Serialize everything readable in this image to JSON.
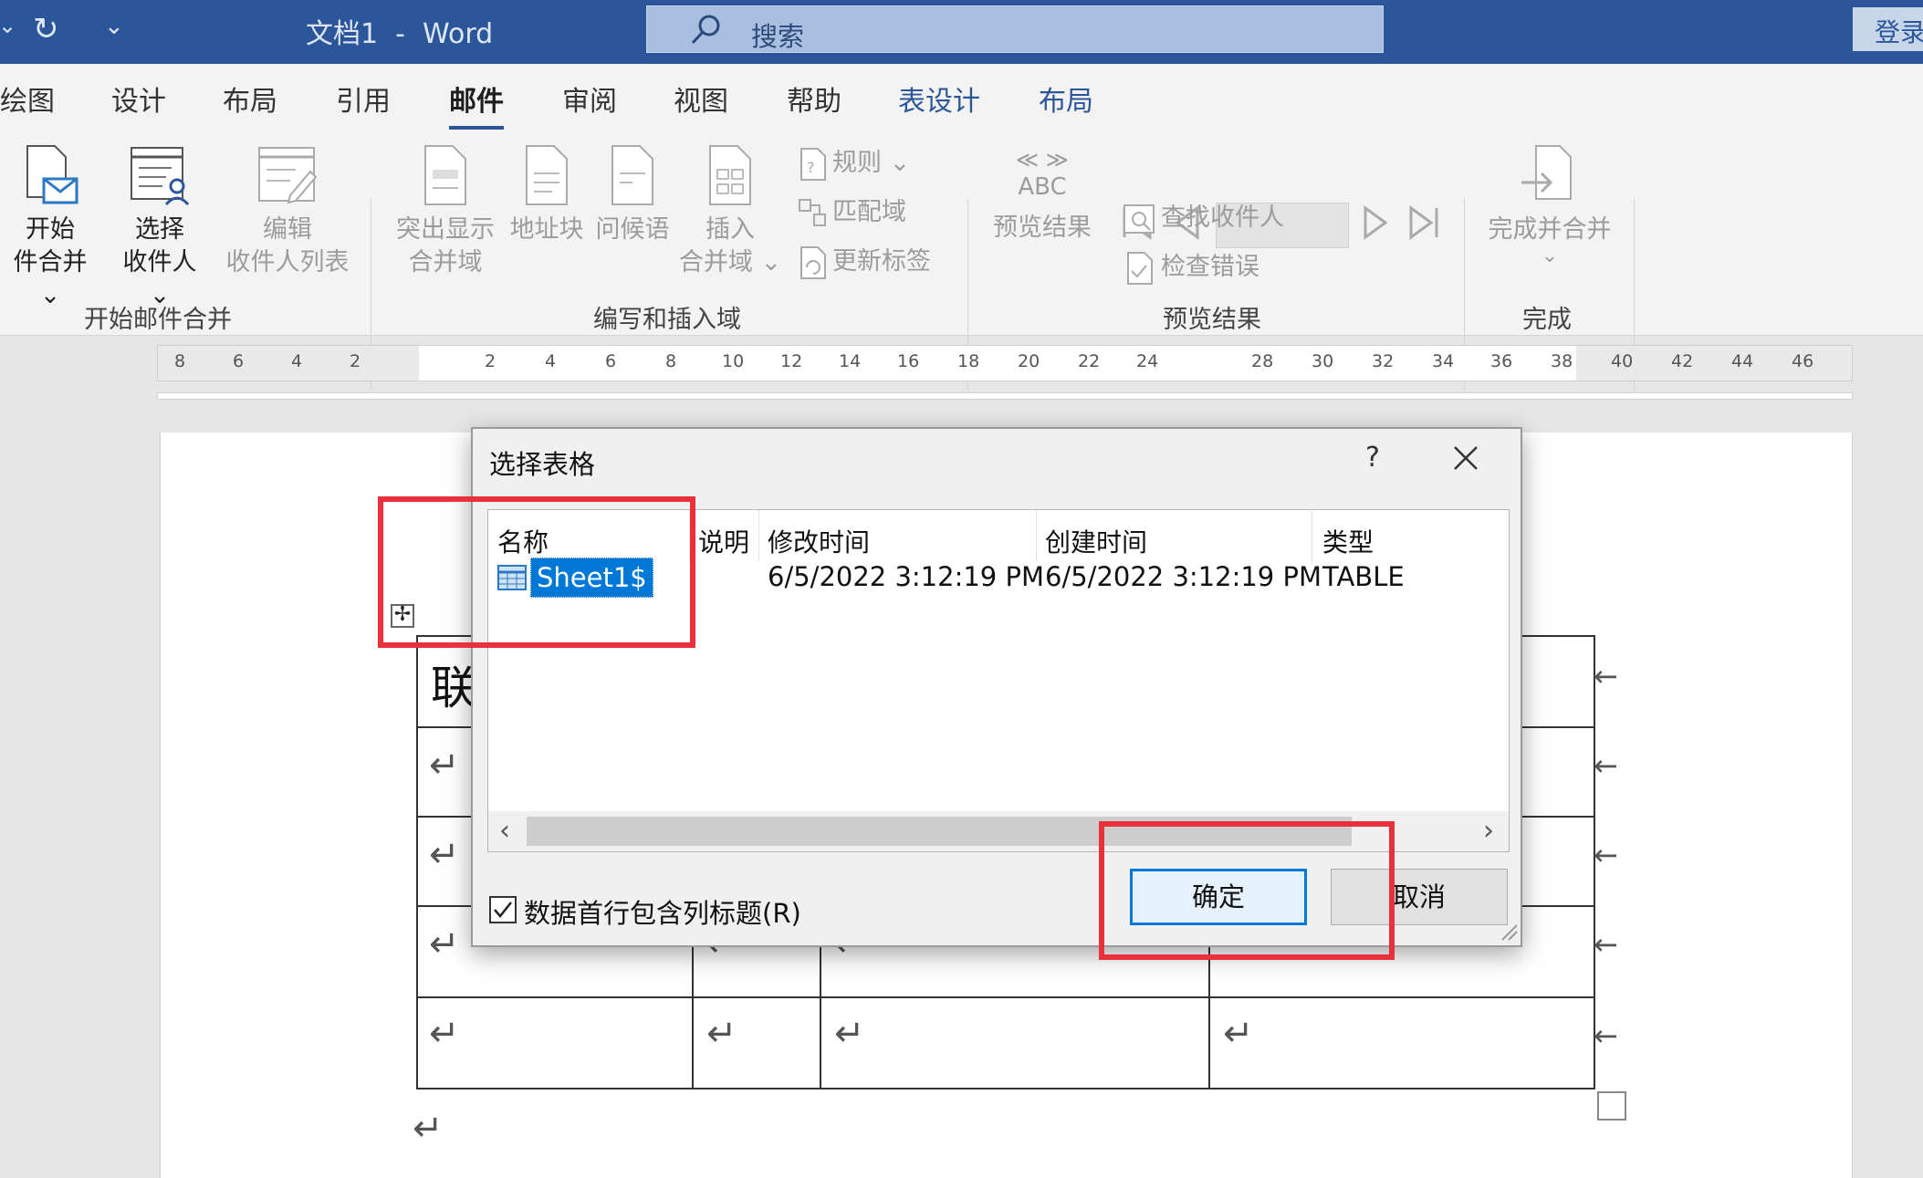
{
  "titlebar": {
    "doc_title": "文档1  -  Word",
    "search_placeholder": "搜索",
    "login": "登录"
  },
  "ribbon": {
    "tabs": [
      "绘图",
      "设计",
      "布局",
      "引用",
      "邮件",
      "审阅",
      "视图",
      "帮助",
      "表设计",
      "布局"
    ],
    "active_tab": "邮件",
    "buttons": {
      "start_merge_l1": "开始",
      "start_merge_l2": "件合并",
      "select_recipients_l1": "选择",
      "select_recipients_l2": "收件人",
      "edit_list_l1": "编辑",
      "edit_list_l2": "收件人列表",
      "highlight_l1": "突出显示",
      "highlight_l2": "合并域",
      "address_block": "地址块",
      "greeting": "问候语",
      "insert_field_l1": "插入",
      "insert_field_l2": "合并域",
      "rules": "规则",
      "match_fields": "匹配域",
      "update_labels": "更新标签",
      "abc": "ABC",
      "preview_results": "预览结果",
      "find_recipient": "查找收件人",
      "check_errors": "检查错误",
      "finish_merge": "完成并合并"
    },
    "groups": {
      "start": "开始邮件合并",
      "write_insert": "编写和插入域",
      "preview": "预览结果",
      "finish": "完成"
    }
  },
  "ruler": {
    "ticks": [
      "8",
      "6",
      "4",
      "2",
      "2",
      "4",
      "6",
      "8",
      "10",
      "12",
      "14",
      "16",
      "18",
      "20",
      "22",
      "24",
      "28",
      "30",
      "32",
      "34",
      "36",
      "38",
      "40",
      "42",
      "44",
      "46"
    ]
  },
  "document": {
    "first_cell_text": "联"
  },
  "dialog": {
    "title": "选择表格",
    "help": "?",
    "columns": [
      "名称",
      "说明",
      "修改时间",
      "创建时间",
      "类型"
    ],
    "row": {
      "name": "Sheet1$",
      "description": "",
      "modified": "6/5/2022 3:12:19 PM",
      "created": "6/5/2022 3:12:19 PM",
      "type": "TABLE"
    },
    "checkbox_label": "数据首行包含列标题(R)",
    "checkbox_checked": true,
    "ok": "确定",
    "cancel": "取消"
  },
  "colors": {
    "word_blue": "#2b579a",
    "selection": "#0078d7",
    "annotation_red": "#e8313a"
  }
}
